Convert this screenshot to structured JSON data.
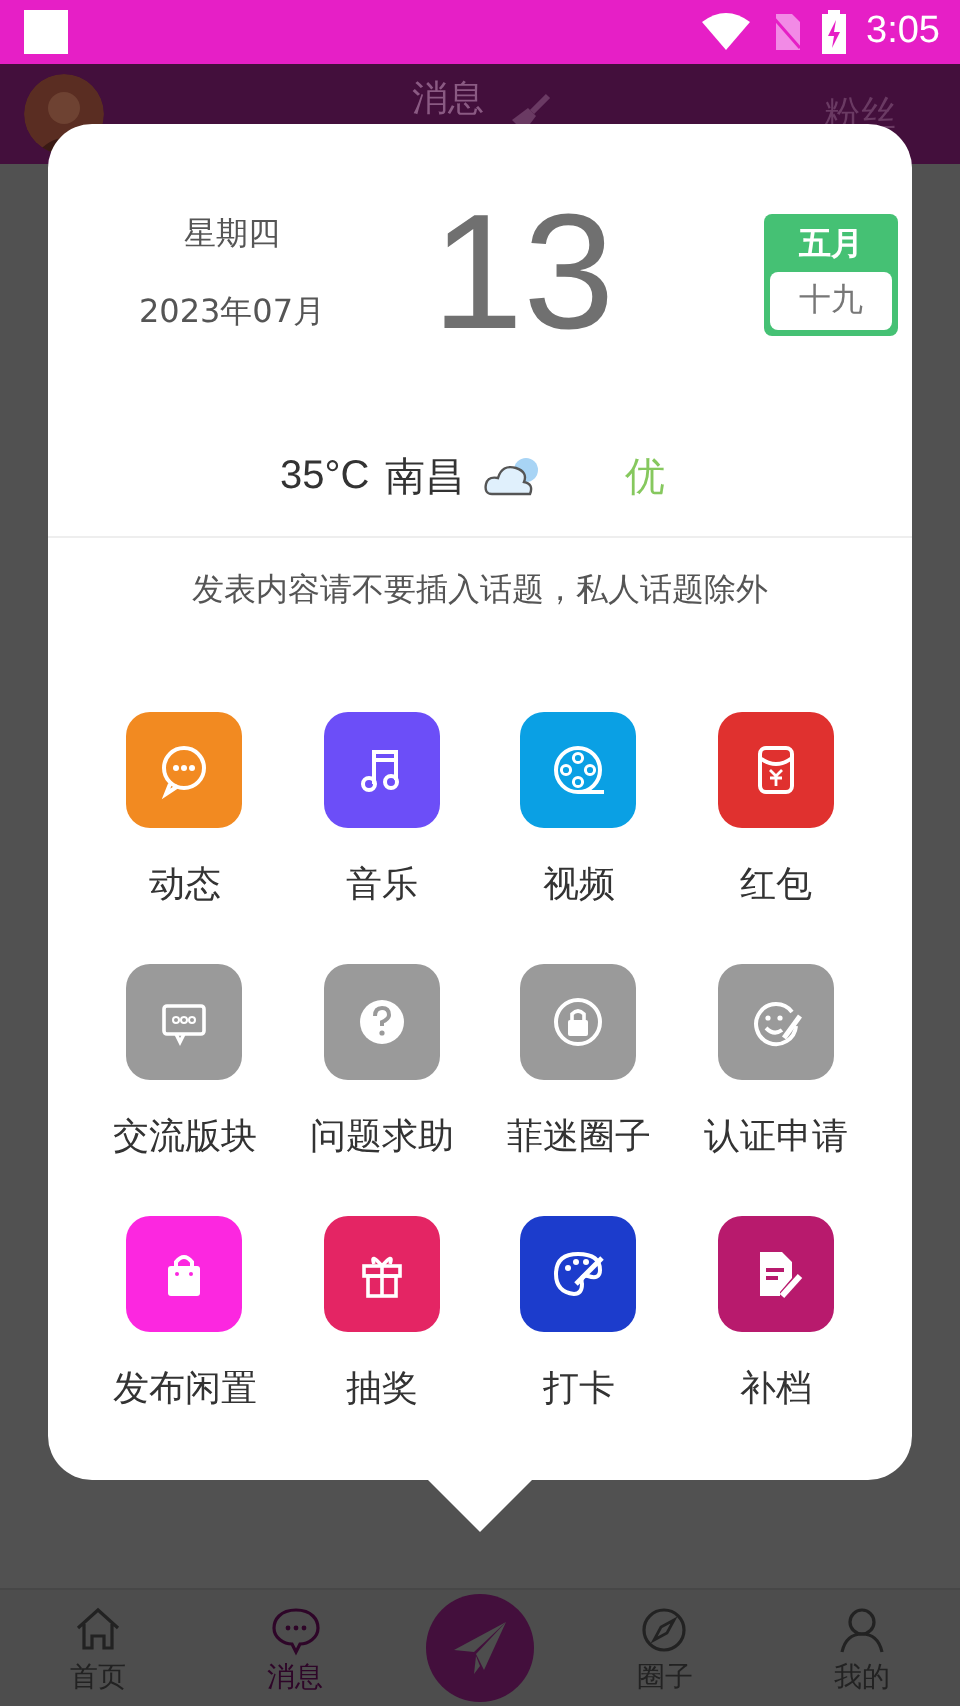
{
  "status_bar": {
    "time": "3:05"
  },
  "header": {
    "title": "消息",
    "right": "粉丝"
  },
  "popup": {
    "weekday": "星期四",
    "year_month": "2023年07月",
    "day": "13",
    "lunar_month": "五月",
    "lunar_day": "十九",
    "temperature": "35°C",
    "city": "南昌",
    "air_quality": "优",
    "notice": "发表内容请不要插入话题，私人话题除外",
    "items": [
      {
        "label": "动态",
        "color": "#f28a21"
      },
      {
        "label": "音乐",
        "color": "#6c4ef8"
      },
      {
        "label": "视频",
        "color": "#0aa0e4"
      },
      {
        "label": "红包",
        "color": "#e0312f"
      },
      {
        "label": "交流版块",
        "color": "#9a9a9a"
      },
      {
        "label": "问题求助",
        "color": "#9a9a9a"
      },
      {
        "label": "菲迷圈子",
        "color": "#9a9a9a"
      },
      {
        "label": "认证申请",
        "color": "#9a9a9a"
      },
      {
        "label": "发布闲置",
        "color": "#fc27e0"
      },
      {
        "label": "抽奖",
        "color": "#e42564"
      },
      {
        "label": "打卡",
        "color": "#1c3ccc"
      },
      {
        "label": "补档",
        "color": "#b81a6d"
      }
    ]
  },
  "bottom_nav": [
    {
      "label": "首页",
      "selected": false
    },
    {
      "label": "消息",
      "selected": true
    },
    {
      "kind": "center"
    },
    {
      "label": "圈子",
      "selected": false
    },
    {
      "label": "我的",
      "selected": false
    }
  ]
}
